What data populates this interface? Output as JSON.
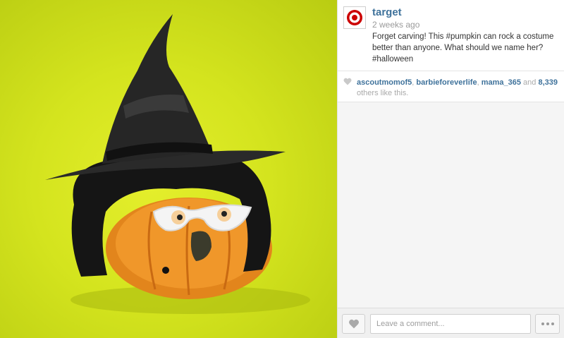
{
  "post": {
    "username": "target",
    "time_ago": "2 weeks ago",
    "caption": "Forget carving! This #pumpkin can rock a costume better than anyone. What should we name her? #halloween",
    "image_icon": "pumpkin-witch-photo"
  },
  "likes": {
    "users": [
      "ascoutmomof5",
      "barbieforeverlife",
      "mama_365"
    ],
    "sep1": ", ",
    "sep2": ", ",
    "and_text": " and ",
    "count": "8,339",
    "suffix": " others like this."
  },
  "footer": {
    "comment_placeholder": "Leave a comment..."
  },
  "colors": {
    "username": "#3f729b",
    "photo_background": "#d4e41e",
    "brand_red": "#cc0000"
  }
}
